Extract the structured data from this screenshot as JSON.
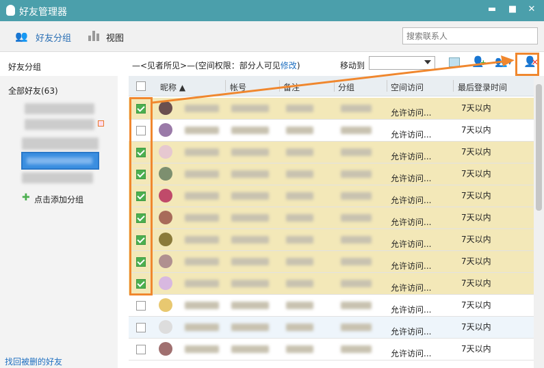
{
  "window": {
    "title": "好友管理器",
    "min": "▬",
    "max": "■",
    "close": "✕"
  },
  "toolbar": {
    "groups": "好友分组",
    "view": "视图",
    "search_placeholder": "搜索联系人"
  },
  "sidebar": {
    "heading": "好友分组",
    "all": "全部好友(63)",
    "add_group": "点击添加分组",
    "recover": "找回被删的好友"
  },
  "main": {
    "group_title": "—<见者所见>—(空间权限：部分人可见",
    "modify": "修改",
    "close_paren": ")",
    "move_to": "移动到"
  },
  "table": {
    "columns": [
      "昵称 ▲",
      "帐号",
      "备注",
      "分组",
      "空间访问",
      "最后登录时间"
    ],
    "rows": [
      {
        "checked": true,
        "access": "允许访问...",
        "last": "7天以内"
      },
      {
        "checked": false,
        "access": "允许访问...",
        "last": "7天以内"
      },
      {
        "checked": true,
        "access": "允许访问...",
        "last": "7天以内"
      },
      {
        "checked": true,
        "access": "允许访问...",
        "last": "7天以内"
      },
      {
        "checked": true,
        "access": "允许访问...",
        "last": "7天以内"
      },
      {
        "checked": true,
        "access": "允许访问...",
        "last": "7天以内"
      },
      {
        "checked": true,
        "access": "允许访问...",
        "last": "7天以内"
      },
      {
        "checked": true,
        "access": "允许访问...",
        "last": "7天以内"
      },
      {
        "checked": true,
        "access": "允许访问...",
        "last": "7天以内"
      },
      {
        "checked": false,
        "access": "允许访问...",
        "last": "7天以内"
      },
      {
        "checked": false,
        "access": "允许访问...",
        "last": "7天以内"
      },
      {
        "checked": false,
        "access": "允许访问...",
        "last": "7天以内"
      }
    ]
  },
  "colors": {
    "titlebar": "#4b9fab",
    "selected_row": "#f3e8b8",
    "accent_orange": "#f0872e",
    "link": "#1e6fc0"
  }
}
